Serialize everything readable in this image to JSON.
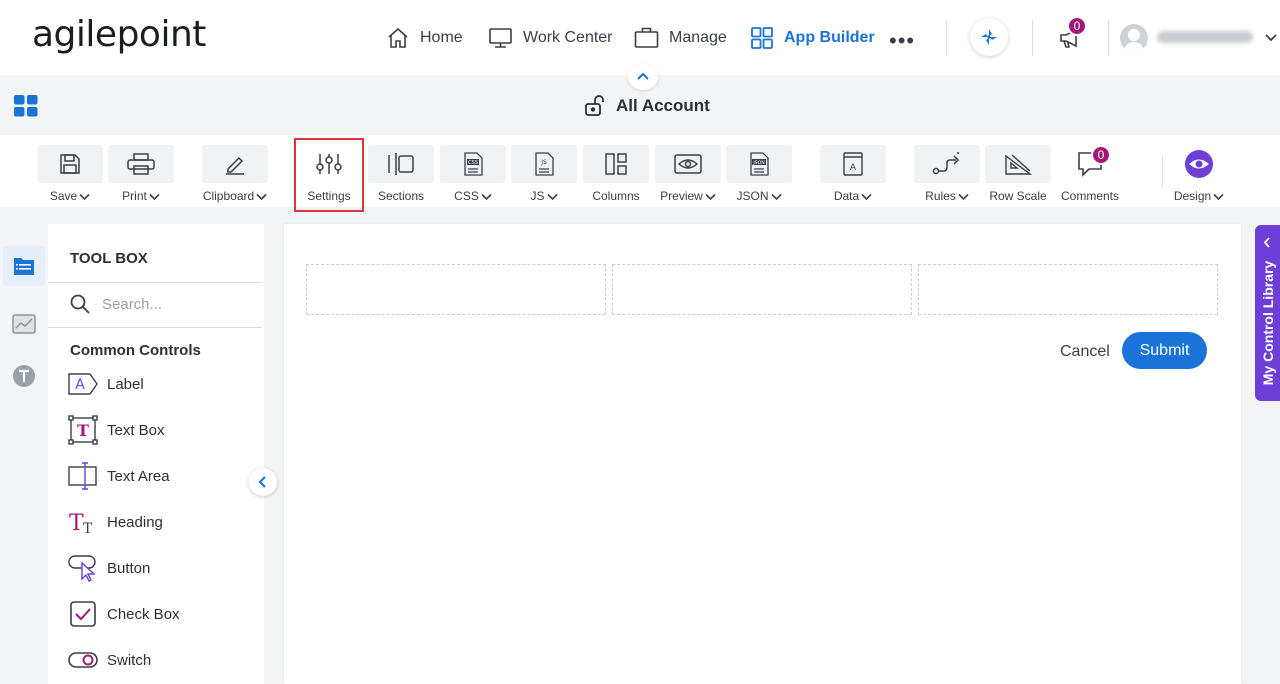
{
  "brand": {
    "logo_text": "agilepoint"
  },
  "nav": {
    "items": [
      {
        "label": "Home",
        "icon": "home-icon"
      },
      {
        "label": "Work Center",
        "icon": "monitor-icon"
      },
      {
        "label": "Manage",
        "icon": "briefcase-icon"
      },
      {
        "label": "App Builder",
        "icon": "grid-icon",
        "active": true
      }
    ],
    "more_label": "•••",
    "notifications_count": "0",
    "accent": "#1a73d6"
  },
  "page": {
    "title": "All Account"
  },
  "toolbar": {
    "save": "Save",
    "print": "Print",
    "clipboard": "Clipboard",
    "settings": "Settings",
    "sections": "Sections",
    "css": "CSS",
    "js": "JS",
    "columns": "Columns",
    "preview": "Preview",
    "json": "JSON",
    "data": "Data",
    "rules": "Rules",
    "row_scale": "Row Scale",
    "comments": "Comments",
    "comments_count": "0",
    "design": "Design"
  },
  "toolbox": {
    "title": "TOOL BOX",
    "search_placeholder": "Search...",
    "section": "Common Controls",
    "controls": [
      "Label",
      "Text Box",
      "Text Area",
      "Heading",
      "Button",
      "Check Box",
      "Switch"
    ]
  },
  "form": {
    "cancel_label": "Cancel",
    "submit_label": "Submit"
  },
  "side_tab": {
    "label": "My Control Library",
    "color": "#6d3fd6"
  }
}
